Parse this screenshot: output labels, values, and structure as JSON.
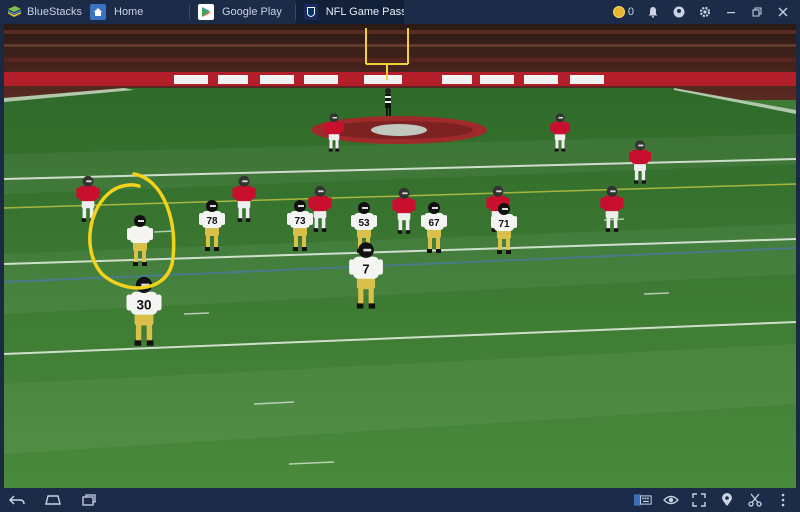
{
  "titlebar": {
    "app_name": "BlueStacks",
    "tabs": [
      {
        "label": "Home",
        "icon": "home-icon"
      },
      {
        "label": "Google Play",
        "icon": "google-play-icon"
      },
      {
        "label": "NFL Game Pass E",
        "icon": "nfl-icon"
      }
    ],
    "coin_count": "0",
    "controls": [
      "bell-icon",
      "account-icon",
      "settings-icon",
      "minimize-icon",
      "restore-icon",
      "close-icon"
    ]
  },
  "scene": {
    "description_hidden": false,
    "jersey_numbers": [
      "78",
      "73",
      "53",
      "67",
      "71",
      "7",
      "30"
    ],
    "annotation_color": "#f2d21a",
    "field_color": "#3f7b35",
    "home_team_color": "#c8102e",
    "away_jersey_color": "#f4f4f2",
    "pants_color": "#d9c04a"
  },
  "bottombar": {
    "left": [
      "back-icon",
      "home-icon",
      "recent-apps-icon"
    ],
    "right": [
      "keyboard-icon",
      "eye-icon",
      "fullscreen-icon",
      "location-icon",
      "scissors-icon",
      "more-icon"
    ]
  }
}
